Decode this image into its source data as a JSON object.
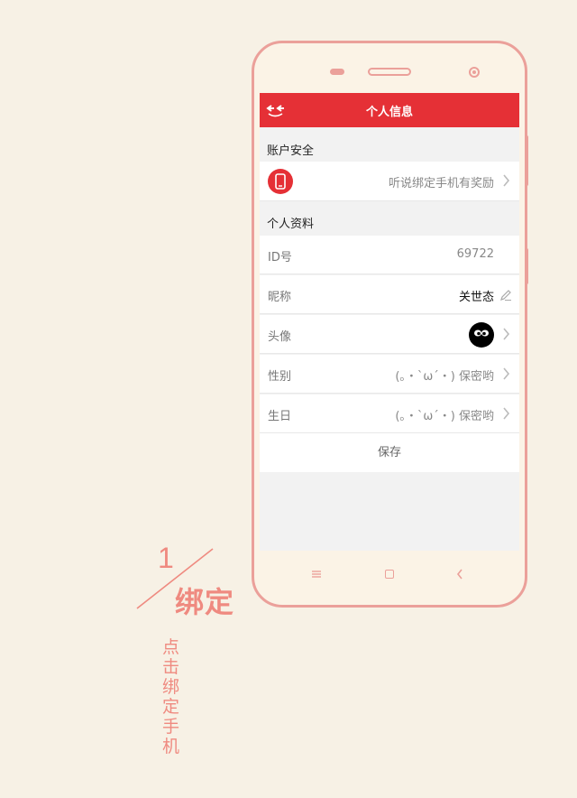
{
  "header": {
    "title": "个人信息"
  },
  "sections": {
    "account_security": "账户安全",
    "personal_profile": "个人资料"
  },
  "bind_phone": {
    "hint": "听说绑定手机有奖励"
  },
  "profile": {
    "id_label": "ID号",
    "id_value": "69722",
    "nickname_label": "昵称",
    "nickname_value": "关世态",
    "avatar_label": "头像",
    "gender_label": "性别",
    "gender_value": "(｡・`ω´・) 保密哟",
    "birthday_label": "生日",
    "birthday_value": "(｡・`ω´・) 保密哟"
  },
  "save_label": "保存",
  "caption": {
    "number": "1",
    "title": "绑定",
    "description": "点击绑定手机"
  },
  "colors": {
    "accent": "#e53036",
    "phone_frame": "#eba09a",
    "background": "#f7f1e5",
    "caption": "#ef8a80"
  },
  "icons": [
    "back-icon",
    "phone-icon",
    "chevron-right-icon",
    "pencil-icon",
    "menu-icon",
    "home-icon",
    "nav-back-icon"
  ]
}
